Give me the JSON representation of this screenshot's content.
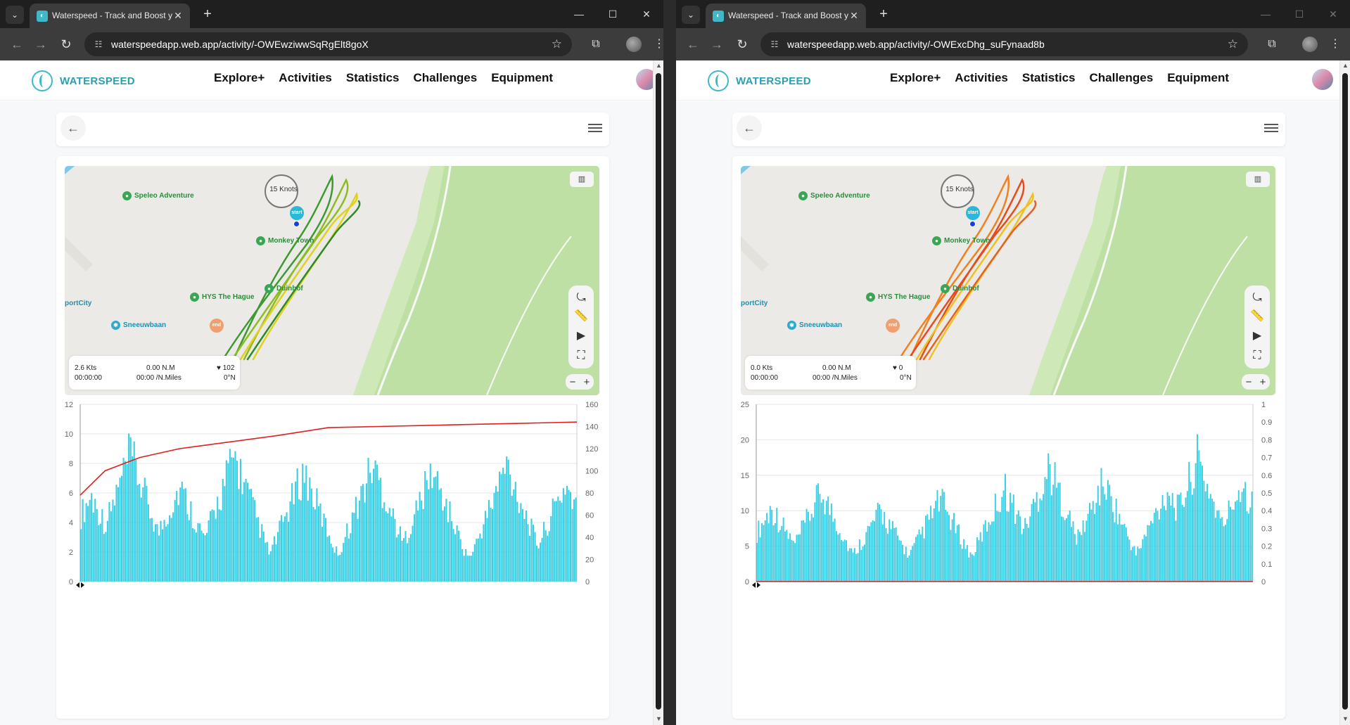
{
  "browser": {
    "tab_title": "Waterspeed - Track and Boost y",
    "windows": [
      {
        "url": "waterspeedapp.web.app/activity/-OWEwziwwSqRgElt8goX"
      },
      {
        "url": "waterspeedapp.web.app/activity/-OWExcDhg_suFynaad8b"
      }
    ]
  },
  "app": {
    "brand": "WATERSPEED",
    "nav": [
      "Explore+",
      "Activities",
      "Statistics",
      "Challenges",
      "Equipment"
    ]
  },
  "map": {
    "compass_label": "15 Knots",
    "markers": {
      "start": "start",
      "end": "end"
    },
    "pois": [
      "Speleo Adventure",
      "Monkey Town",
      "HYS The Hague",
      "Duinhof",
      "portCity",
      "Sneeuwbaan"
    ]
  },
  "activities": [
    {
      "stats": {
        "speed": "2.6 Kts",
        "distance": "0.00 N.M",
        "heart": "102",
        "time": "00:00:00",
        "pace": "00:00 /N.Miles",
        "heading": "0°N"
      },
      "chart_data": {
        "type": "bar",
        "left_axis": {
          "ticks": [
            0,
            2,
            4,
            6,
            8,
            10,
            12
          ],
          "ylim": [
            0,
            12
          ],
          "unit": "knots"
        },
        "right_axis": {
          "ticks": [
            0,
            20,
            40,
            60,
            80,
            100,
            120,
            140,
            160
          ],
          "ylim": [
            0,
            160
          ]
        },
        "series": [
          {
            "kind": "bar",
            "color": "#3ccfe3",
            "axis": "left",
            "count": 280,
            "peaks": [
              [
                0.02,
                7.0
              ],
              [
                0.1,
                10.4
              ],
              [
                0.2,
                7.7
              ],
              [
                0.31,
                10.3
              ],
              [
                0.45,
                9.0
              ],
              [
                0.59,
                9.6
              ],
              [
                0.71,
                9.0
              ],
              [
                0.86,
                9.6
              ],
              [
                0.98,
                8.0
              ]
            ]
          },
          {
            "kind": "line",
            "color": "#e02020",
            "axis": "right",
            "points": [
              [
                0.0,
                78
              ],
              [
                0.05,
                100
              ],
              [
                0.12,
                112
              ],
              [
                0.2,
                120
              ],
              [
                0.3,
                126
              ],
              [
                0.4,
                132
              ],
              [
                0.5,
                139
              ],
              [
                0.6,
                140
              ],
              [
                0.7,
                141
              ],
              [
                0.8,
                142
              ],
              [
                0.9,
                143
              ],
              [
                1.0,
                144
              ]
            ]
          }
        ]
      }
    },
    {
      "stats": {
        "speed": "0.0 Kts",
        "distance": "0.00 N.M",
        "heart": "0",
        "time": "00:00:00",
        "pace": "00:00 /N.Miles",
        "heading": "0°N"
      },
      "chart_data": {
        "type": "bar",
        "left_axis": {
          "ticks": [
            0,
            5,
            10,
            15,
            20,
            25
          ],
          "ylim": [
            0,
            25
          ],
          "unit": "knots"
        },
        "right_axis": {
          "ticks": [
            0,
            0.1,
            0.2,
            0.3,
            0.4,
            0.5,
            0.6,
            0.7,
            0.8,
            0.9,
            1.0
          ],
          "ylim": [
            0,
            1.0
          ]
        },
        "series": [
          {
            "kind": "bar",
            "color": "#3ccfe3",
            "axis": "left",
            "count": 300,
            "peaks": [
              [
                0.03,
                12.5
              ],
              [
                0.13,
                15.3
              ],
              [
                0.25,
                12.0
              ],
              [
                0.37,
                14.0
              ],
              [
                0.5,
                16.0
              ],
              [
                0.59,
                19.6
              ],
              [
                0.7,
                17.0
              ],
              [
                0.83,
                15.7
              ],
              [
                0.89,
                21.0
              ],
              [
                0.98,
                17.0
              ]
            ]
          },
          {
            "kind": "line",
            "color": "#e02020",
            "axis": "right",
            "points": [
              [
                0.0,
                0
              ],
              [
                1.0,
                0
              ]
            ]
          }
        ]
      }
    }
  ]
}
